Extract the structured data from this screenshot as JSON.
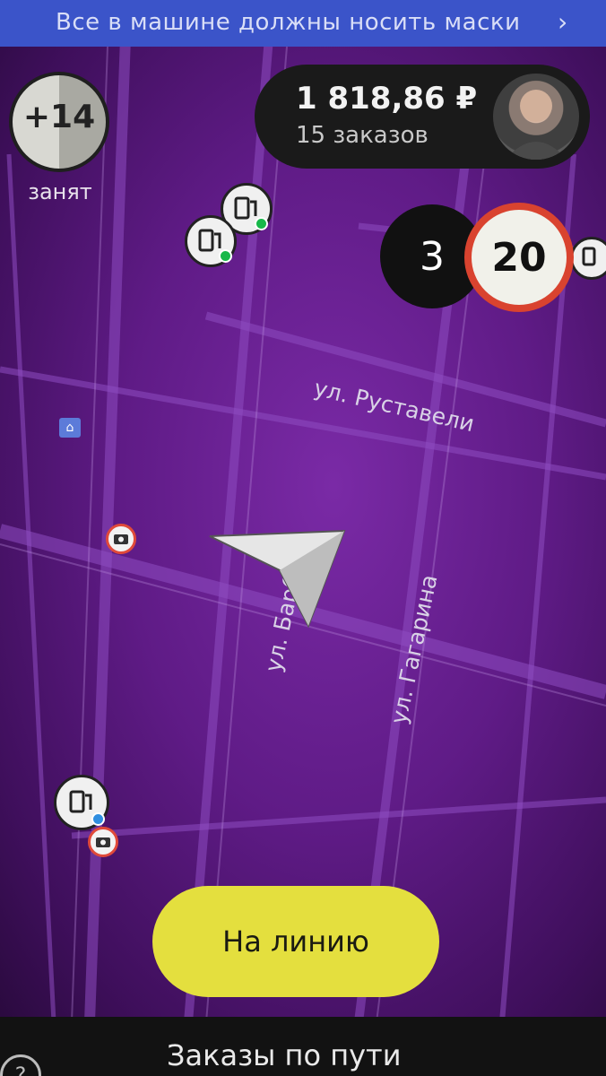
{
  "banner": {
    "text": "Все в машине должны носить маски",
    "arrow": "›"
  },
  "bonus": {
    "value": "+14",
    "status": "занят"
  },
  "earnings": {
    "amount": "1 818,86 ₽",
    "orders": "15 заказов",
    "avatar_icon": "driver-avatar"
  },
  "speed": {
    "current": "3",
    "limit": "20"
  },
  "streets": {
    "rustaveli": "ул. Руставели",
    "gagarina": "ул. Гагарина",
    "barbyusa": "ул. Барб"
  },
  "poi_icons": [
    "gas-station-icon",
    "gas-station-icon",
    "gas-station-icon",
    "gas-station-icon"
  ],
  "camera_icons": [
    "camera-icon",
    "camera-icon"
  ],
  "buttons": {
    "online": "На линию"
  },
  "bottom_sheet": {
    "title": "Заказы по пути",
    "help": "?"
  },
  "colors": {
    "map": "#6a2197",
    "banner": "#3b54c9",
    "primary_button": "#e4df3e",
    "speed_limit_border": "#d9432f"
  }
}
